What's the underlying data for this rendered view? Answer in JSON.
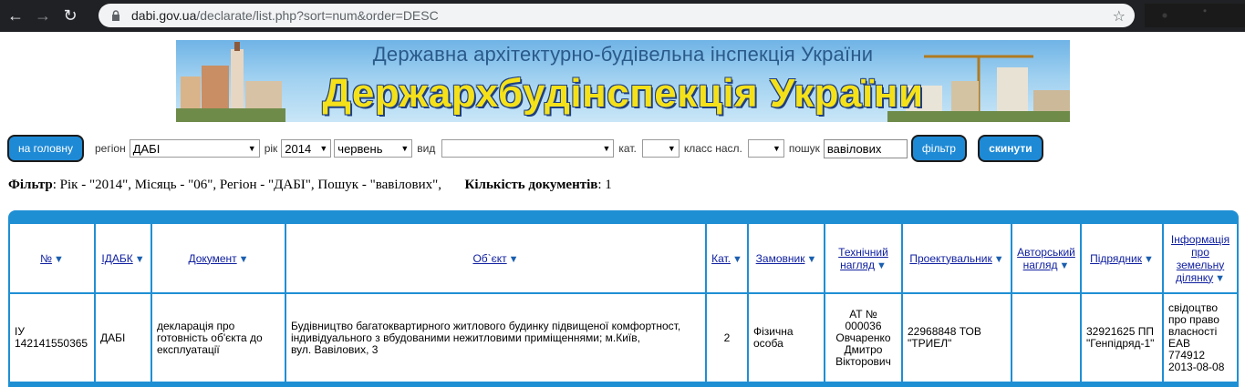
{
  "browser": {
    "url_host": "dabi.gov.ua",
    "url_path": "/declarate/list.php?sort=num&order=DESC"
  },
  "banner": {
    "subtitle": "Державна архітектурно-будівельна інспекція України",
    "title": "Держархбудінспекція України"
  },
  "toolbar": {
    "home_button": "на головну",
    "region_label": "регіон",
    "region_value": "ДАБІ",
    "year_label": "рік",
    "year_value": "2014",
    "month_value": "червень",
    "type_label": "вид",
    "type_value": "",
    "cat_label": "кат.",
    "cat_value": "",
    "class_label": "класс насл.",
    "class_value": "",
    "search_label": "пошук",
    "search_value": "вавілових",
    "filter_button": "фільтр",
    "reset_button": "скинути"
  },
  "filter_summary": {
    "filter_label": "Фільтр",
    "filter_text": ": Рік - \"2014\", Місяць - \"06\", Регіон - \"ДАБІ\", Пошук - \"вавілових\",",
    "count_label": "Кількість документів",
    "count_value": ": 1"
  },
  "table": {
    "headers": {
      "num": "№",
      "idabk": "ІДАБК",
      "document": "Документ",
      "object": "Об`єкт",
      "cat": "Кат.",
      "customer": "Замовник",
      "tech1": "Технічний",
      "tech2": "нагляд",
      "designer": "Проектувальник",
      "author1": "Авторський",
      "author2": "нагляд",
      "contractor": "Підрядник",
      "land1": "Інформація",
      "land2": "про",
      "land3": "земельну",
      "land4": "ділянку"
    },
    "row": {
      "num1": "ІУ",
      "num2": "142141550365",
      "idabk": "ДАБІ",
      "document": "декларація про готовність об'єкта до експлуатації",
      "object1": "Будівництво багатоквартирного житлового будинку підвищеної комфортност,",
      "object2": "індивідуального з вбудованими нежитловими приміщеннями; м.Київ,",
      "object3": "вул. Вавілових, 3",
      "cat": "2",
      "customer": "Фізична особа",
      "tech1": "АТ № 000036",
      "tech2": "Овчаренко",
      "tech3": "Дмитро",
      "tech4": "Вікторович",
      "designer": "22968848 ТОВ \"ТРИЕЛ\"",
      "author": "",
      "contractor": "32921625 ПП \"Генпідряд-1\"",
      "land1": "свідоцтво",
      "land2": "про право",
      "land3": "власності",
      "land4": "ЕАВ",
      "land5": "774912",
      "land6": "2013-08-08"
    }
  },
  "colors": {
    "accent": "#1f8fd4",
    "button": "#1e8ad6",
    "header_link": "#1020a0",
    "banner_title": "#f5e11a"
  }
}
